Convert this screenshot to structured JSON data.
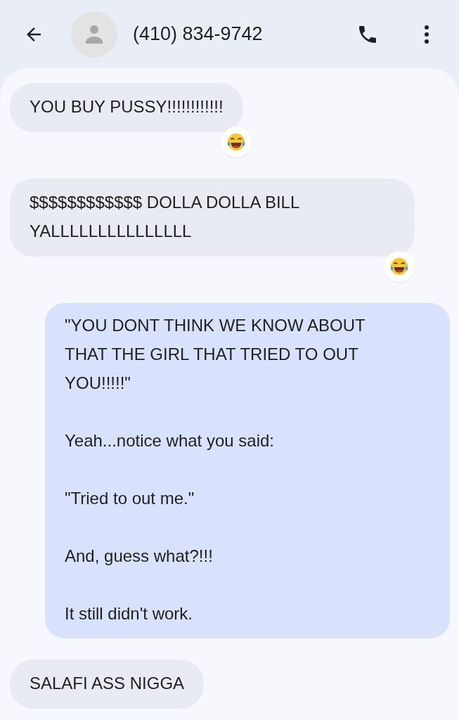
{
  "header": {
    "title": "(410) 834-9742"
  },
  "messages": [
    {
      "kind": "incoming",
      "paragraphs": [
        "YOU BUY PUSSY!!!!!!!!!!!!"
      ],
      "reacted": true
    },
    {
      "kind": "incoming",
      "paragraphs": [
        "$$$$$$$$$$$$ DOLLA DOLLA BILL YALLLLLLLLLLLLLLL"
      ],
      "reacted": true
    },
    {
      "kind": "outgoing",
      "paragraphs": [
        "\"YOU DONT THINK WE KNOW ABOUT THAT THE GIRL THAT TRIED TO OUT YOU!!!!!\"",
        "Yeah...notice what you said:",
        "\"Tried to out me.\"",
        "And, guess what?!!!",
        "It still didn't work."
      ]
    },
    {
      "kind": "incoming",
      "paragraphs": [
        "SALAFI ASS NIGGA"
      ]
    }
  ]
}
